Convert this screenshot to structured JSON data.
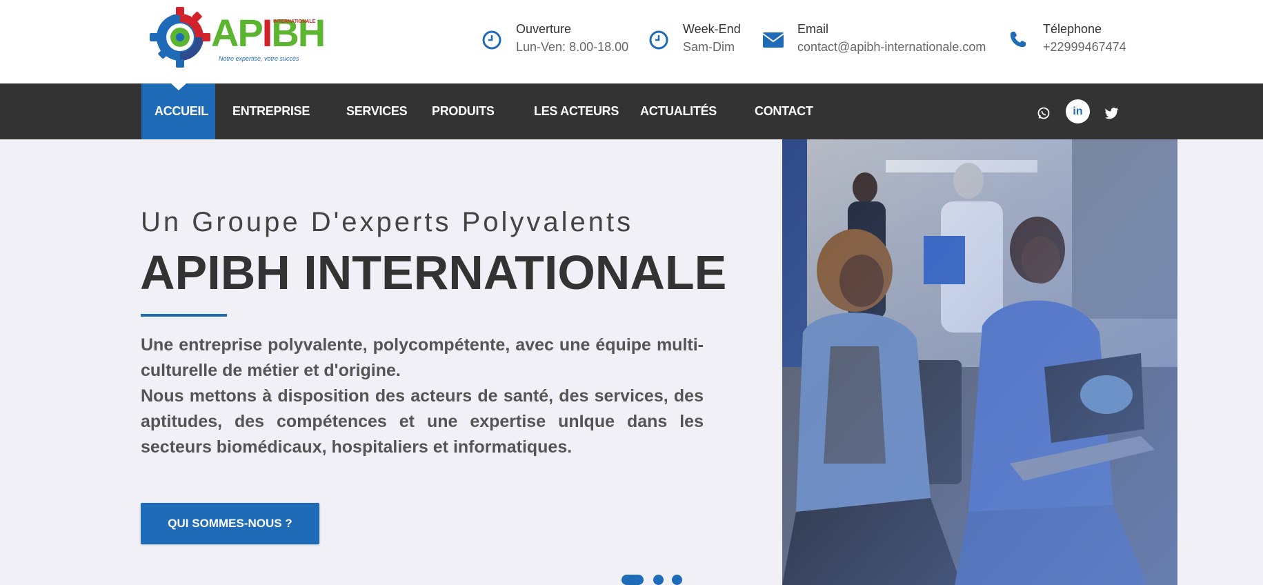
{
  "header": {
    "logo": {
      "brand_a": "AP",
      "brand_i": "I",
      "brand_b": "BH",
      "intl": "INTERNATIONALE",
      "tagline": "Notre expertise, votre succès"
    },
    "info": [
      {
        "icon": "clock-icon",
        "label": "Ouverture",
        "value": "Lun-Ven: 8.00-18.00"
      },
      {
        "icon": "clock-icon",
        "label": "Week-End",
        "value": "Sam-Dim"
      },
      {
        "icon": "envelope-icon",
        "label": "Email",
        "value": "contact@apibh-internationale.com"
      },
      {
        "icon": "phone-icon",
        "label": "Télephone",
        "value": "+22999467474"
      }
    ]
  },
  "nav": {
    "items": [
      "ACCUEIL",
      "ENTREPRISE",
      "SERVICES",
      "PRODUITS",
      "LES ACTEURS",
      "ACTUALITÉS",
      "CONTACT"
    ],
    "active": "ACCUEIL",
    "social": [
      "whatsapp-icon",
      "linkedin-icon",
      "twitter-icon"
    ],
    "linkedin_label": "in"
  },
  "hero": {
    "subtitle": "Un Groupe D'experts Polyvalents",
    "title": "APIBH INTERNATIONALE",
    "paragraph1": "Une entreprise polyvalente, polycompétente, avec une équipe multi-culturelle de métier et d'origine.",
    "paragraph2": "Nous mettons à disposition des acteurs de santé, des services, des aptitudes, des compétences et une expertise unIque dans les secteurs biomédicaux, hospitaliers et informatiques.",
    "button": "QUI SOMMES-NOUS ?",
    "slides": {
      "count": 3,
      "active": 1
    }
  },
  "colors": {
    "accent": "#1f6bb8",
    "nav_bg": "#333333",
    "hero_bg": "#f0f0f6",
    "logo_green": "#5cb531",
    "logo_red": "#d2232a"
  }
}
